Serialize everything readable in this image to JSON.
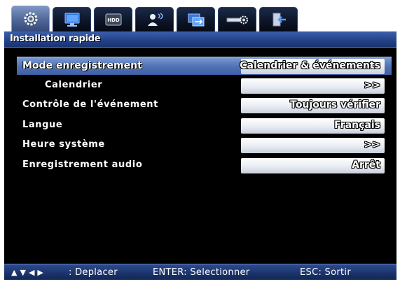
{
  "tabs": [
    {
      "name": "gear-icon",
      "active": true
    },
    {
      "name": "monitor-icon",
      "active": false
    },
    {
      "name": "hdd-icon",
      "active": false,
      "label": "HDD"
    },
    {
      "name": "user-network-icon",
      "active": false
    },
    {
      "name": "network-icon",
      "active": false
    },
    {
      "name": "device-settings-icon",
      "active": false
    },
    {
      "name": "exit-icon",
      "active": false
    }
  ],
  "title": "Installation rapide",
  "rows": [
    {
      "label": "Mode enregistrement",
      "value": "Calendrier & événements",
      "highlighted": true,
      "indent": false
    },
    {
      "label": "Calendrier",
      "value": ">>",
      "highlighted": false,
      "indent": true
    },
    {
      "label": "Contrôle de l'événement",
      "value": "Toujours vérifier",
      "highlighted": false,
      "indent": false
    },
    {
      "label": "Langue",
      "value": "Français",
      "highlighted": false,
      "indent": false
    },
    {
      "label": "Heure système",
      "value": ">>",
      "highlighted": false,
      "indent": false
    },
    {
      "label": "Enregistrement audio",
      "value": "Arrêt",
      "highlighted": false,
      "indent": false
    }
  ],
  "footer": {
    "move": ": Deplacer",
    "enter": "ENTER: Selectionner",
    "esc": "ESC: Sortir"
  }
}
